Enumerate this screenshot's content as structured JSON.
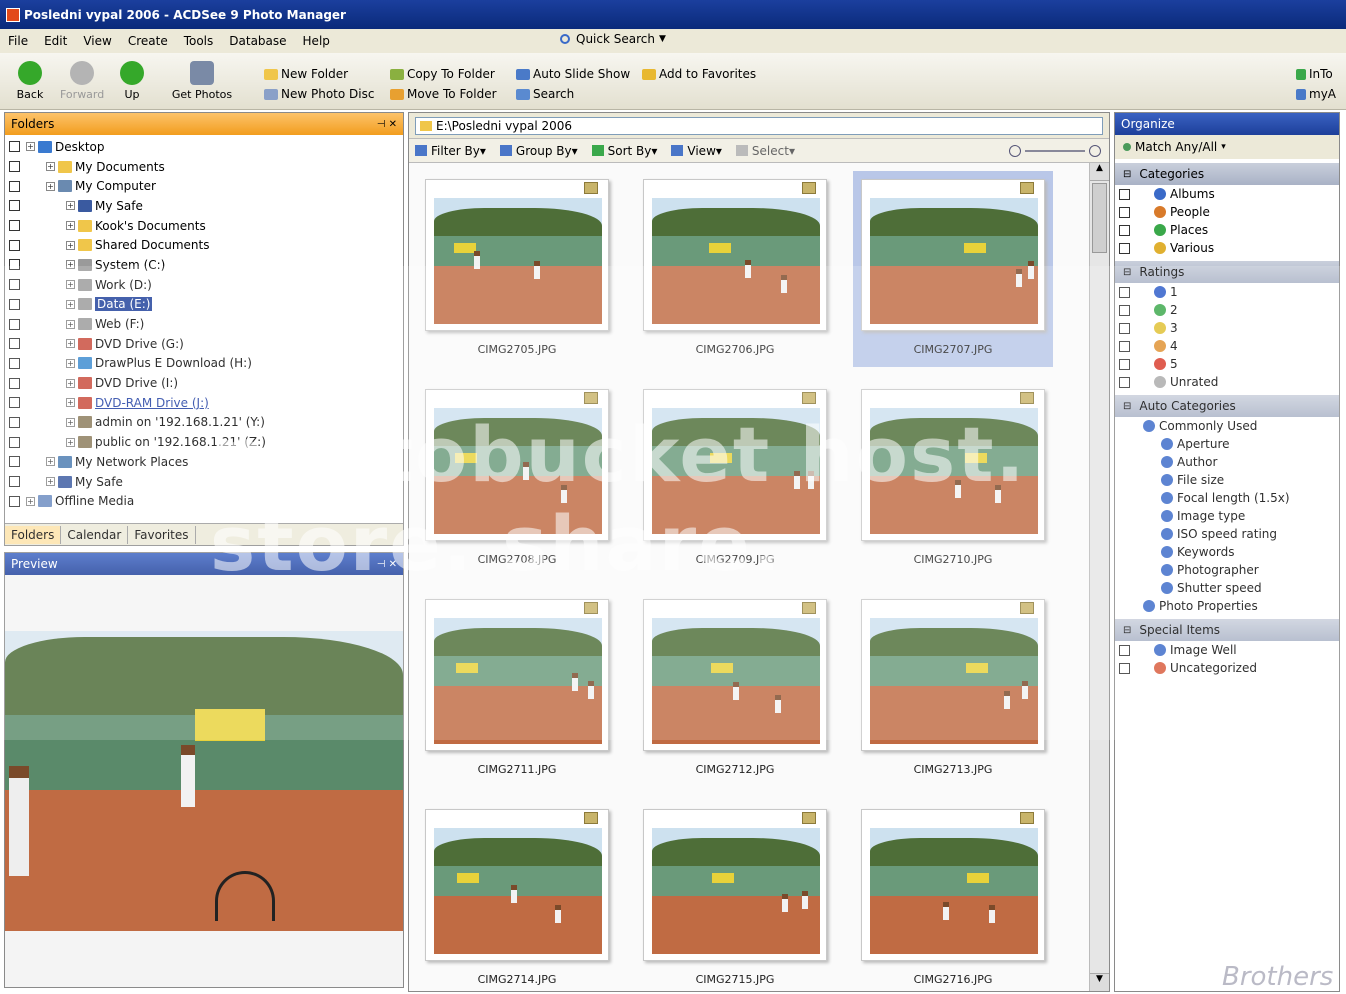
{
  "window": {
    "title": "Posledni vypal 2006 - ACDSee 9 Photo Manager"
  },
  "menu": [
    "File",
    "Edit",
    "View",
    "Create",
    "Tools",
    "Database",
    "Help"
  ],
  "quick_search": "Quick Search",
  "toolbar": {
    "nav": [
      {
        "label": "Back",
        "color": "#35a82a"
      },
      {
        "label": "Forward",
        "color": "#b4b4b4"
      },
      {
        "label": "Up",
        "color": "#35a82a"
      },
      {
        "label": "Get Photos",
        "color": "#7a8aa6"
      }
    ],
    "actions_row1": [
      "New Folder",
      "Copy To Folder",
      "Auto Slide Show",
      "Add to Favorites"
    ],
    "actions_row2": [
      "New Photo Disc",
      "Move To Folder",
      "Search"
    ],
    "right": [
      "InTo",
      "myA"
    ]
  },
  "folders": {
    "title": "Folders",
    "items": [
      {
        "label": "Desktop",
        "indent": 0,
        "color": "#3a7ad0"
      },
      {
        "label": "My Documents",
        "indent": 1,
        "color": "#f0c64a"
      },
      {
        "label": "My Computer",
        "indent": 1,
        "color": "#6a8ab0"
      },
      {
        "label": "My Safe",
        "indent": 2,
        "color": "#3a5aa0"
      },
      {
        "label": "Kook's Documents",
        "indent": 2,
        "color": "#f0c64a"
      },
      {
        "label": "Shared Documents",
        "indent": 2,
        "color": "#f0c64a"
      },
      {
        "label": "System (C:)",
        "indent": 2,
        "color": "#9a9a9a"
      },
      {
        "label": "Work (D:)",
        "indent": 2,
        "color": "#9a9a9a"
      },
      {
        "label": "Data (E:)",
        "indent": 2,
        "color": "#9a9a9a",
        "selected": true
      },
      {
        "label": "Web (F:)",
        "indent": 2,
        "color": "#9a9a9a"
      },
      {
        "label": "DVD Drive (G:)",
        "indent": 2,
        "color": "#c84a3a"
      },
      {
        "label": "DrawPlus E Download (H:)",
        "indent": 2,
        "color": "#3a8ad0"
      },
      {
        "label": "DVD Drive (I:)",
        "indent": 2,
        "color": "#c84a3a"
      },
      {
        "label": "DVD-RAM Drive (J:)",
        "indent": 2,
        "color": "#c84a3a",
        "link": true
      },
      {
        "label": "admin on '192.168.1.21' (Y:)",
        "indent": 2,
        "color": "#8a7a5a"
      },
      {
        "label": "public on '192.168.1.21' (Z:)",
        "indent": 2,
        "color": "#8a7a5a"
      },
      {
        "label": "My Network Places",
        "indent": 1,
        "color": "#4a7ab0"
      },
      {
        "label": "My Safe",
        "indent": 1,
        "color": "#3a5aa0"
      },
      {
        "label": "Offline Media",
        "indent": 0,
        "color": "#6a8ac0"
      }
    ],
    "tabs": [
      "Folders",
      "Calendar",
      "Favorites"
    ]
  },
  "preview": {
    "title": "Preview"
  },
  "browser": {
    "path": "E:\\Posledni vypal 2006",
    "view_buttons": [
      "Filter By",
      "Group By",
      "Sort By",
      "View",
      "Select"
    ],
    "thumbnails": [
      {
        "file": "CIMG2705.JPG"
      },
      {
        "file": "CIMG2706.JPG"
      },
      {
        "file": "CIMG2707.JPG",
        "selected": true
      },
      {
        "file": "CIMG2708.JPG"
      },
      {
        "file": "CIMG2709.JPG"
      },
      {
        "file": "CIMG2710.JPG"
      },
      {
        "file": "CIMG2711.JPG"
      },
      {
        "file": "CIMG2712.JPG"
      },
      {
        "file": "CIMG2713.JPG"
      },
      {
        "file": "CIMG2714.JPG"
      },
      {
        "file": "CIMG2715.JPG"
      },
      {
        "file": "CIMG2716.JPG"
      }
    ]
  },
  "organize": {
    "title": "Organize",
    "match": "Match Any/All",
    "categories_title": "Categories",
    "categories": [
      {
        "label": "Albums",
        "color": "#3a6ac8"
      },
      {
        "label": "People",
        "color": "#d87a2a"
      },
      {
        "label": "Places",
        "color": "#3aa84a"
      },
      {
        "label": "Various",
        "color": "#e0b030"
      }
    ],
    "ratings_title": "Ratings",
    "ratings": [
      {
        "label": "1",
        "color": "#2a5ac8"
      },
      {
        "label": "2",
        "color": "#3aa84a"
      },
      {
        "label": "3",
        "color": "#e0c030"
      },
      {
        "label": "4",
        "color": "#e09030"
      },
      {
        "label": "5",
        "color": "#d83a2a"
      },
      {
        "label": "Unrated",
        "color": "#aaaaaa"
      }
    ],
    "auto_title": "Auto Categories",
    "auto_root": "Commonly Used",
    "auto_items": [
      "Aperture",
      "Author",
      "File size",
      "Focal length (1.5x)",
      "Image type",
      "ISO speed rating",
      "Keywords",
      "Photographer",
      "Shutter speed"
    ],
    "auto_after": "Photo Properties",
    "special_title": "Special Items",
    "special": [
      {
        "label": "Image Well",
        "color": "#3a6ac8"
      },
      {
        "label": "Uncategorized",
        "color": "#d85a3a"
      }
    ]
  },
  "watermark": "photobucket host. store. share.",
  "watermark2": "Brothers"
}
